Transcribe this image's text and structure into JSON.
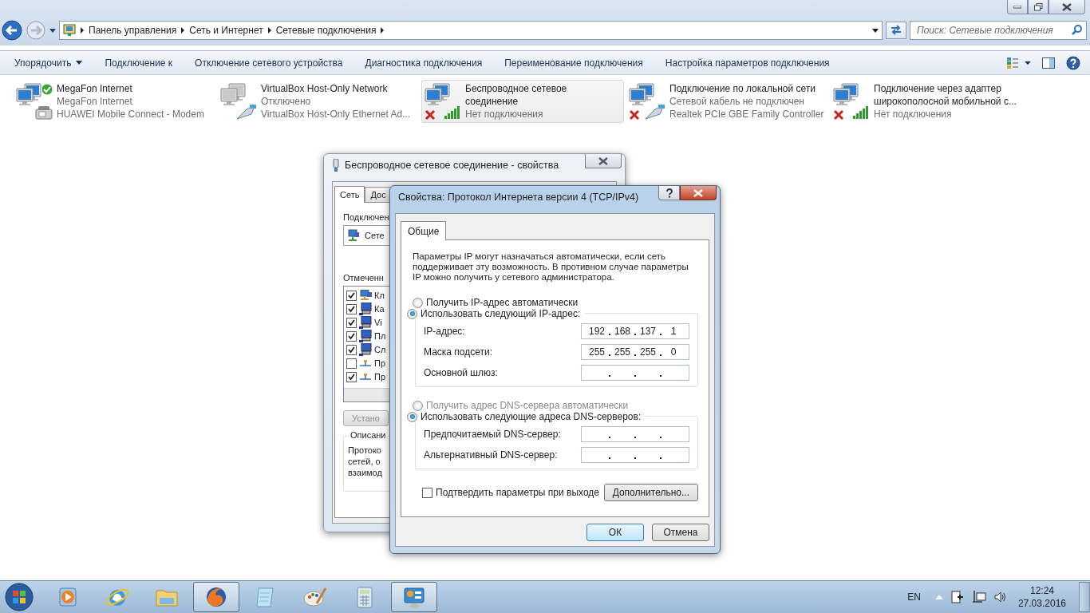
{
  "explorer": {
    "breadcrumb": [
      "Панель управления",
      "Сеть и Интернет",
      "Сетевые подключения"
    ],
    "search": {
      "placeholder": "Поиск: Сетевые подключения"
    },
    "toolbar": [
      {
        "label": "Упорядочить",
        "kind": "menu"
      },
      {
        "label": "Подключение к",
        "kind": "command"
      },
      {
        "label": "Отключение сетевого устройства",
        "kind": "command"
      },
      {
        "label": "Диагностика подключения",
        "kind": "command"
      },
      {
        "label": "Переименование подключения",
        "kind": "command"
      },
      {
        "label": "Настройка параметров подключения",
        "kind": "command"
      }
    ],
    "connections": [
      {
        "name": "MegaFon Internet",
        "status": "MegaFon Internet",
        "device": "HUAWEI Mobile Connect - Modem",
        "kind": "modem",
        "connected": true,
        "disabled": false,
        "error": false,
        "selected": false
      },
      {
        "name": "VirtualBox Host-Only Network",
        "status": "Отключено",
        "device": "VirtualBox Host-Only Ethernet Ad...",
        "kind": "ethernet",
        "connected": false,
        "disabled": true,
        "error": false,
        "selected": false
      },
      {
        "name": "Беспроводное сетевое соединение",
        "status": "Нет подключения",
        "kind": "wireless",
        "connected": false,
        "disabled": false,
        "error": true,
        "selected": true
      },
      {
        "name": "Подключение по локальной сети",
        "status": "Сетевой кабель не подключен",
        "device": "Realtek PCIe GBE Family Controller",
        "kind": "ethernet",
        "connected": false,
        "disabled": false,
        "error": true,
        "selected": false
      },
      {
        "name": "Подключение через адаптер широкополосной мобильной с...",
        "status": "Нет подключения",
        "kind": "wireless",
        "connected": false,
        "disabled": false,
        "error": true,
        "selected": false
      }
    ]
  },
  "properties_dialog": {
    "title": "Беспроводное сетевое соединение - свойства",
    "tabs": [
      {
        "label": "Сеть",
        "selected": true
      },
      {
        "label": "Дос",
        "selected": false
      }
    ],
    "connect_label": "Подключен",
    "adapter": "Сете",
    "components_label": "Отмеченн",
    "components": [
      {
        "label": "Кл",
        "checked": true,
        "kind": "client"
      },
      {
        "label": "Ка",
        "checked": true,
        "kind": "service"
      },
      {
        "label": "Vi",
        "checked": true,
        "kind": "service"
      },
      {
        "label": "Пл",
        "checked": true,
        "kind": "service"
      },
      {
        "label": "Сл",
        "checked": true,
        "kind": "service"
      },
      {
        "label": "Пр",
        "checked": false,
        "kind": "protocol"
      },
      {
        "label": "Пр",
        "checked": true,
        "kind": "protocol"
      }
    ],
    "install_button": "Устано",
    "description_label": "Описани",
    "description_lines": [
      "Протоко",
      "сетей, о",
      "взаимод"
    ]
  },
  "ipv4_dialog": {
    "title": "Свойства: Протокол Интернета версии 4 (TCP/IPv4)",
    "tabs": [
      {
        "label": "Общие",
        "selected": true
      }
    ],
    "intro": "Параметры IP могут назначаться автоматически, если сеть поддерживает эту возможность. В противном случае параметры IP можно получить у сетевого администратора.",
    "ip_options": [
      {
        "label": "Получить IP-адрес автоматически",
        "selected": false,
        "disabled": false
      },
      {
        "label": "Использовать следующий IP-адрес:",
        "selected": true,
        "disabled": false
      }
    ],
    "ip_fields": [
      {
        "label": "IP-адрес:",
        "octets": [
          "192",
          "168",
          "137",
          "1"
        ]
      },
      {
        "label": "Маска подсети:",
        "octets": [
          "255",
          "255",
          "255",
          "0"
        ]
      },
      {
        "label": "Основной шлюз:"
      }
    ],
    "dns_options": [
      {
        "label": "Получить адрес DNS-сервера автоматически",
        "selected": false,
        "disabled": true
      },
      {
        "label": "Использовать следующие адреса DNS-серверов:",
        "selected": true,
        "disabled": false
      }
    ],
    "dns_fields": [
      {
        "label": "Предпочитаемый DNS-сервер:"
      },
      {
        "label": "Альтернативный DNS-сервер:"
      }
    ],
    "validate": {
      "label": "Подтвердить параметры при выходе",
      "checked": false
    },
    "advanced_button": "Дополнительно...",
    "buttons": [
      {
        "label": "ОК",
        "kind": "default"
      },
      {
        "label": "Отмена",
        "kind": "normal"
      }
    ]
  },
  "taskbar": {
    "apps": [
      {
        "kind": "media",
        "active": false
      },
      {
        "kind": "browser-e",
        "active": false
      },
      {
        "kind": "folder",
        "active": false
      },
      {
        "kind": "fox",
        "active": true
      },
      {
        "kind": "notepad",
        "active": false
      },
      {
        "kind": "paint",
        "active": false
      },
      {
        "kind": "calculator",
        "active": false
      },
      {
        "kind": "panel",
        "active": true
      }
    ],
    "language": "EN",
    "time": "12:24",
    "date": "27.03.2016"
  }
}
